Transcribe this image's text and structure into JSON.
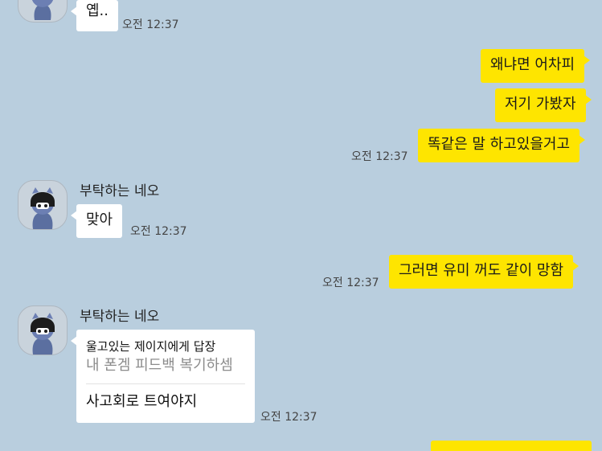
{
  "messages": {
    "m1": {
      "text": "옙..",
      "time": "오전 12:37"
    },
    "m2": {
      "text": "왜냐면 어차피"
    },
    "m3": {
      "text": "저기 가봤자"
    },
    "m4": {
      "text": "똑같은 말 하고있을거고",
      "time": "오전 12:37"
    },
    "m5": {
      "sender": "부탁하는 네오",
      "text": "맞아",
      "time": "오전 12:37"
    },
    "m6": {
      "text": "그러면 유미 꺼도 같이 망함",
      "time": "오전 12:37"
    },
    "m7": {
      "sender": "부탁하는 네오",
      "reply_title": "울고있는 제이지에게 답장",
      "reply_quote": "내 폰겜 피드백 복기하셈",
      "text": "사고회로 트여야지",
      "time": "오전 12:37"
    }
  }
}
